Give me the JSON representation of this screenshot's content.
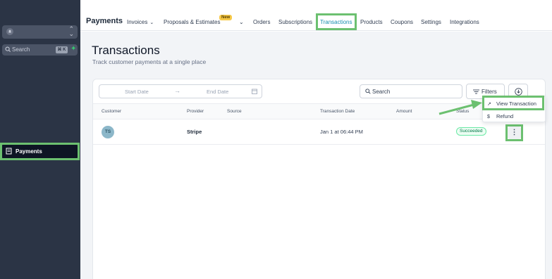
{
  "sidebar": {
    "search_placeholder": "Search",
    "search_shortcut": "⌘ K",
    "active_item": "Payments"
  },
  "topnav": {
    "section_title": "Payments",
    "items": [
      "Invoices",
      "Proposals & Estimates",
      "Orders",
      "Subscriptions",
      "Transactions",
      "Products",
      "Coupons",
      "Settings",
      "Integrations"
    ],
    "new_badge": "New",
    "active_tab": "Transactions"
  },
  "page": {
    "title": "Transactions",
    "subtitle": "Track customer payments at a single place"
  },
  "toolbar": {
    "start_date_placeholder": "Start Date",
    "end_date_placeholder": "End Date",
    "search_placeholder": "Search",
    "filters_label": "Filters"
  },
  "table": {
    "columns": [
      "Customer",
      "Provider",
      "Source",
      "Transaction Date",
      "Amount",
      "Status"
    ],
    "rows": [
      {
        "avatar_initials": "TS",
        "provider": "Stripe",
        "source": "",
        "date": "Jan 1 at 06:44 PM",
        "amount": "",
        "status": "Succeeded"
      }
    ]
  },
  "row_menu": {
    "items": [
      "View Transaction",
      "Refund"
    ]
  },
  "colors": {
    "highlight": "#6cc070",
    "sidebar_bg": "#2b3445",
    "accent": "#1a8fb0",
    "success": "#027a48"
  }
}
